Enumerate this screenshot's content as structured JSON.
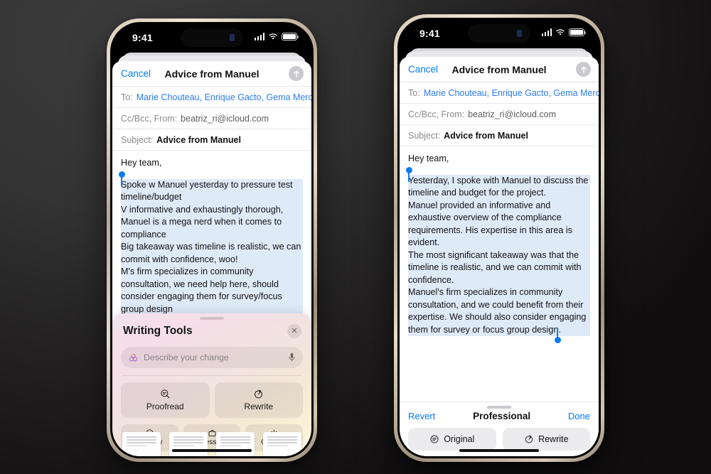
{
  "scene": {
    "background_color": "#333333",
    "description": "Two iPhone mockups side by side showing Apple Mail compose with Writing Tools"
  },
  "status_bar": {
    "time": "9:41",
    "cellular_icon": "cellular-bars-icon",
    "wifi_icon": "wifi-icon",
    "battery_icon": "battery-icon"
  },
  "compose": {
    "cancel_label": "Cancel",
    "title": "Advice from Manuel",
    "send_icon": "send-arrow-up-icon",
    "to_label": "To:",
    "to_value": "Marie Chouteau, Enrique Gacto, Gema Merchán",
    "cc_label": "Cc/Bcc, From:",
    "cc_value": "beatriz_ri@icloud.com",
    "subject_label": "Subject:",
    "subject_value": "Advice from Manuel",
    "greeting": "Hey team,"
  },
  "left_phone": {
    "body_original": [
      "Spoke w Manuel yesterday to pressure test timeline/budget",
      "V informative and exhaustingly thorough, Manuel is a mega nerd when it comes to compliance",
      "Big takeaway was timeline is realistic, we can commit with confidence, woo!",
      "M's firm specializes in community consultation, we need help here, should consider engaging them for survey/focus group design"
    ],
    "writing_tools": {
      "title": "Writing Tools",
      "close_icon": "close-icon",
      "orb_icon": "apple-intelligence-orb-icon",
      "input_placeholder": "Describe your change",
      "mic_icon": "microphone-icon",
      "primary_actions": [
        {
          "label": "Proofread",
          "icon": "proofread-magnifier-icon"
        },
        {
          "label": "Rewrite",
          "icon": "rewrite-clock-icon"
        }
      ],
      "tone_actions": [
        {
          "label": "Friendly",
          "icon": "smiley-face-icon"
        },
        {
          "label": "Professional",
          "icon": "briefcase-icon"
        },
        {
          "label": "Concise",
          "icon": "concise-asterisk-icon"
        }
      ]
    }
  },
  "right_phone": {
    "body_rewritten": [
      "Yesterday, I spoke with Manuel to discuss the timeline and budget for the project.",
      "Manuel provided an informative and exhaustive overview of the compliance requirements. His expertise in this area is evident.",
      "The most significant takeaway was that the timeline is realistic, and we can commit with confidence.",
      "Manuel's firm specializes in community consultation, and we could benefit from their expertise. We should also consider engaging them for survey or focus group design."
    ],
    "rewrite_bar": {
      "revert_label": "Revert",
      "mode_label": "Professional",
      "done_label": "Done",
      "buttons": [
        {
          "label": "Original",
          "icon": "original-text-icon"
        },
        {
          "label": "Rewrite",
          "icon": "rewrite-clock-icon"
        }
      ]
    }
  },
  "colors": {
    "accent_blue": "#007aff",
    "selection_blue": "#dfeaf9",
    "handle_blue": "#0a7bf0"
  }
}
